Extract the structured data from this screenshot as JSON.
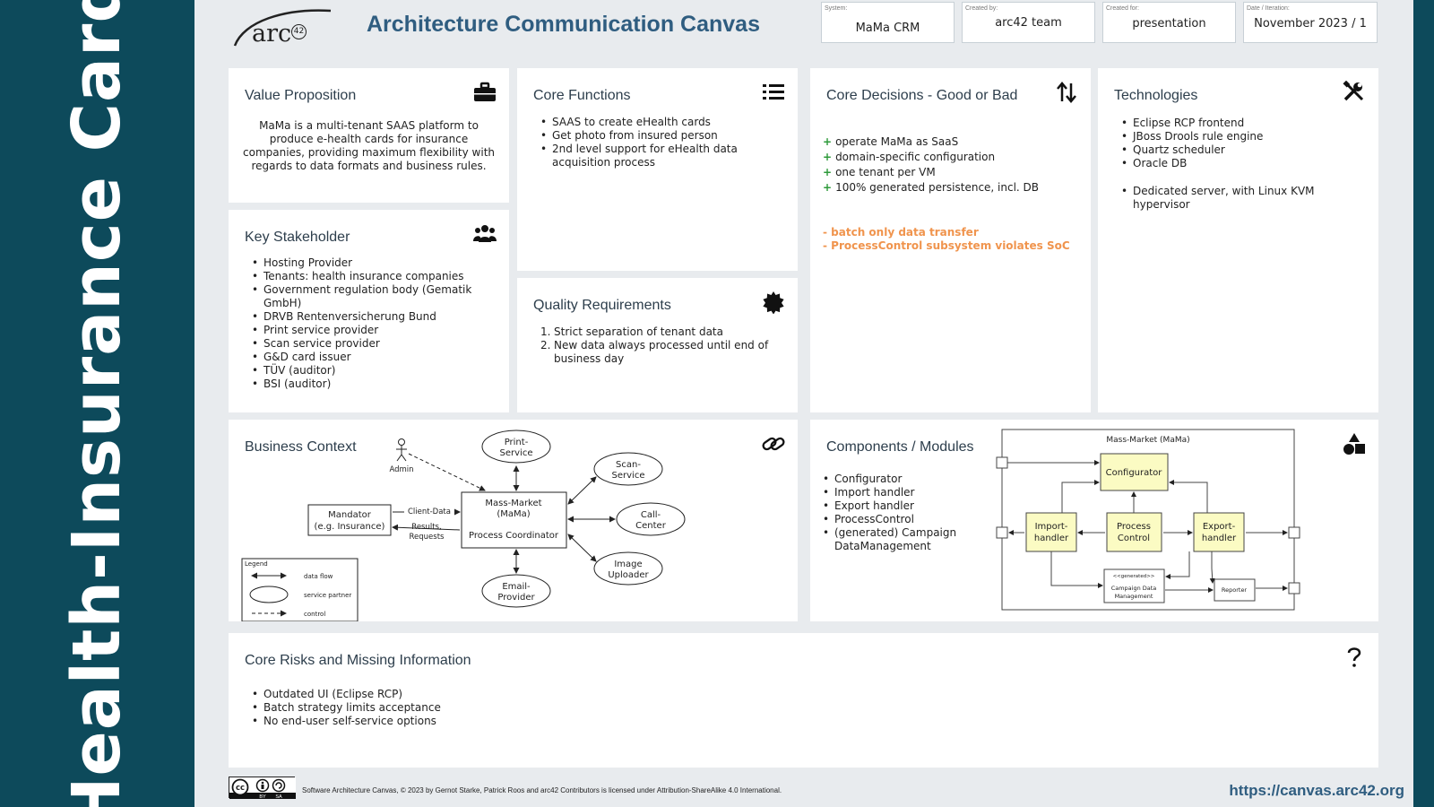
{
  "side_title": "Health-Insurance Card",
  "logo": {
    "text": "arc",
    "sub": "42"
  },
  "title": "Architecture Communication Canvas",
  "meta": [
    {
      "label": "System:",
      "value": "MaMa CRM"
    },
    {
      "label": "Created by:",
      "value": "arc42 team"
    },
    {
      "label": "Created for:",
      "value": "presentation"
    },
    {
      "label": "Date / Iteration:",
      "value": "November 2023 / 1"
    }
  ],
  "value_proposition": {
    "title": "Value Proposition",
    "icon": "briefcase-icon",
    "text": "MaMa is a multi-tenant SAAS platform to produce e-health cards for insurance companies, providing maximum flexibility with regards to data formats and business rules."
  },
  "key_stakeholder": {
    "title": "Key Stakeholder",
    "icon": "people-icon",
    "items": [
      "Hosting Provider",
      "Tenants: health insurance companies",
      "Government regulation body (Gematik GmbH)",
      "DRVB Rentenversicherung Bund",
      "Print service provider",
      "Scan service provider",
      "G&D card issuer",
      "TÜV (auditor)",
      "BSI (auditor)"
    ]
  },
  "core_functions": {
    "title": "Core Functions",
    "icon": "list-icon",
    "items": [
      "SAAS to create eHealth cards",
      "Get photo from insured person",
      "2nd level support for eHealth data acquisition process"
    ]
  },
  "quality_requirements": {
    "title": "Quality Requirements",
    "icon": "rosette-icon",
    "items": [
      "Strict separation of tenant data",
      "New data always processed until end of business day"
    ]
  },
  "core_decisions": {
    "title": "Core Decisions - Good or Bad",
    "icon": "up-down-arrows-icon",
    "good": [
      "operate MaMa as SaaS",
      "domain-specific configuration",
      "one tenant per VM",
      "100% generated persistence, incl. DB"
    ],
    "bad": [
      "- batch only data transfer",
      "- ProcessControl subsystem violates SoC"
    ],
    "good_color": "#2e9a3a",
    "bad_color": "#f0944d"
  },
  "technologies": {
    "title": "Technologies",
    "icon": "tools-icon",
    "items": [
      "Eclipse RCP frontend",
      "JBoss Drools rule engine",
      "Quartz scheduler",
      "Oracle DB"
    ],
    "items2": [
      "Dedicated server, with Linux KVM hypervisor"
    ]
  },
  "business_context": {
    "title": "Business Context",
    "icon": "link-icon",
    "nodes": {
      "admin": "Admin",
      "print_1": "Print-",
      "print_2": "Service",
      "scan_1": "Scan-",
      "scan_2": "Service",
      "call_1": "Call-",
      "call_2": "Center",
      "image_1": "Image",
      "image_2": "Uploader",
      "email_1": "Email-",
      "email_2": "Provider",
      "mandator_1": "Mandator",
      "mandator_2": "(e.g. Insurance)",
      "mama_1": "Mass-Market",
      "mama_2": "(MaMa)",
      "mama_3": "Process Coordinator",
      "client_data": "Client-Data",
      "results_1": "Results,",
      "results_2": "Requests"
    },
    "legend": {
      "title": "Legend",
      "data_flow": "data flow",
      "service_partner": "service partner",
      "control": "control"
    }
  },
  "components": {
    "title": "Components / Modules",
    "icon": "shapes-icon",
    "items": [
      "Configurator",
      "Import handler",
      "Export handler",
      "ProcessControl",
      "(generated) Campaign DataManagement"
    ],
    "diagram": {
      "container": "Mass-Market (MaMa)",
      "configurator": "Configurator",
      "import_1": "Import-",
      "import_2": "handler",
      "process_1": "Process",
      "process_2": "Control",
      "export_1": "Export-",
      "export_2": "handler",
      "generated": "<<generated>>",
      "campaign_1": "Campaign Data",
      "campaign_2": "Management",
      "reporter": "Reporter"
    }
  },
  "core_risks": {
    "title": "Core Risks and Missing Information",
    "icon": "question-icon",
    "items": [
      "Outdated UI (Eclipse RCP)",
      "Batch strategy limits acceptance",
      "No end-user self-service options"
    ]
  },
  "footer": {
    "license": "Software Architecture Canvas, © 2023 by Gernot Starke, Patrick Roos and arc42 Contributors is licensed under Attribution-ShareAlike 4.0 International.",
    "url": "https://canvas.arc42.org",
    "cc_badge": {
      "cc": "cc",
      "by": "BY",
      "sa": "SA"
    }
  }
}
